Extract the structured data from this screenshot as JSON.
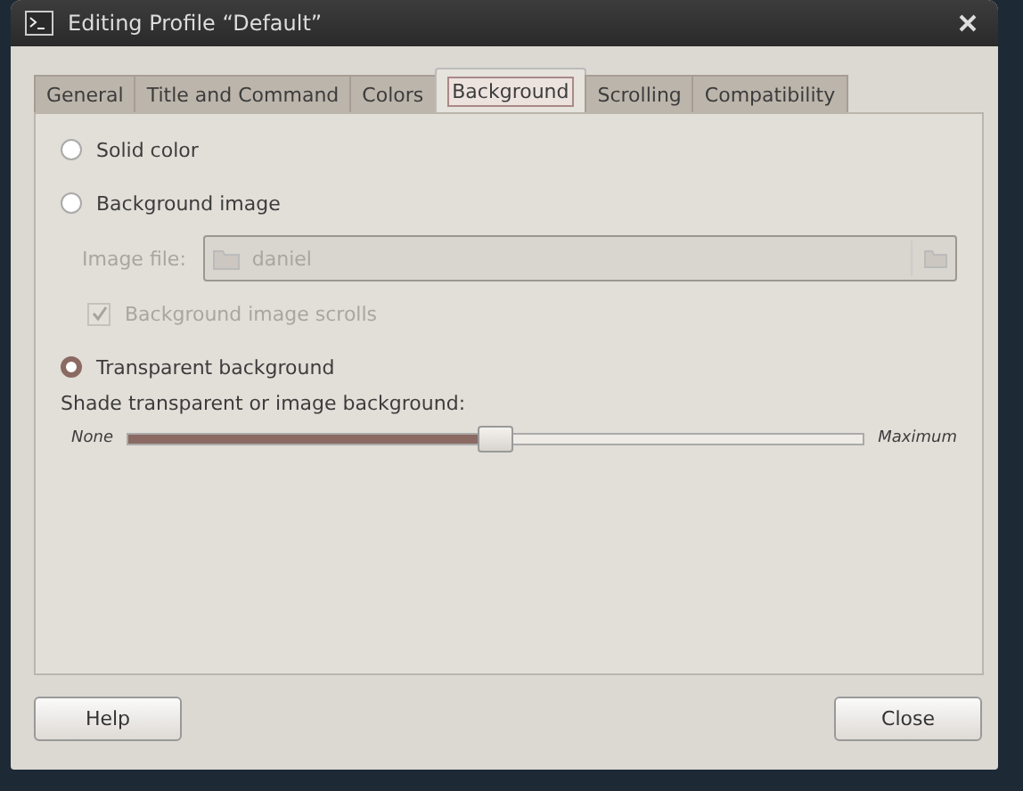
{
  "window": {
    "title": "Editing Profile “Default”"
  },
  "tabs": [
    {
      "label": "General",
      "selected": false
    },
    {
      "label": "Title and Command",
      "selected": false
    },
    {
      "label": "Colors",
      "selected": false
    },
    {
      "label": "Background",
      "selected": true
    },
    {
      "label": "Scrolling",
      "selected": false
    },
    {
      "label": "Compatibility",
      "selected": false
    }
  ],
  "background_type": [
    {
      "label": "Solid color",
      "selected": false
    },
    {
      "label": "Background image",
      "selected": false
    }
  ],
  "image_file": {
    "label": "Image file:",
    "value": "daniel",
    "disabled": true
  },
  "image_scrolls": {
    "label": "Background image scrolls",
    "checked": true,
    "disabled": true
  },
  "transparent": {
    "label": "Transparent background",
    "selected": true
  },
  "shade": {
    "label": "Shade transparent or image background:",
    "min_label": "None",
    "max_label": "Maximum",
    "level": 0.5
  },
  "buttons": [
    {
      "label": "Help"
    },
    {
      "label": "Close"
    }
  ]
}
